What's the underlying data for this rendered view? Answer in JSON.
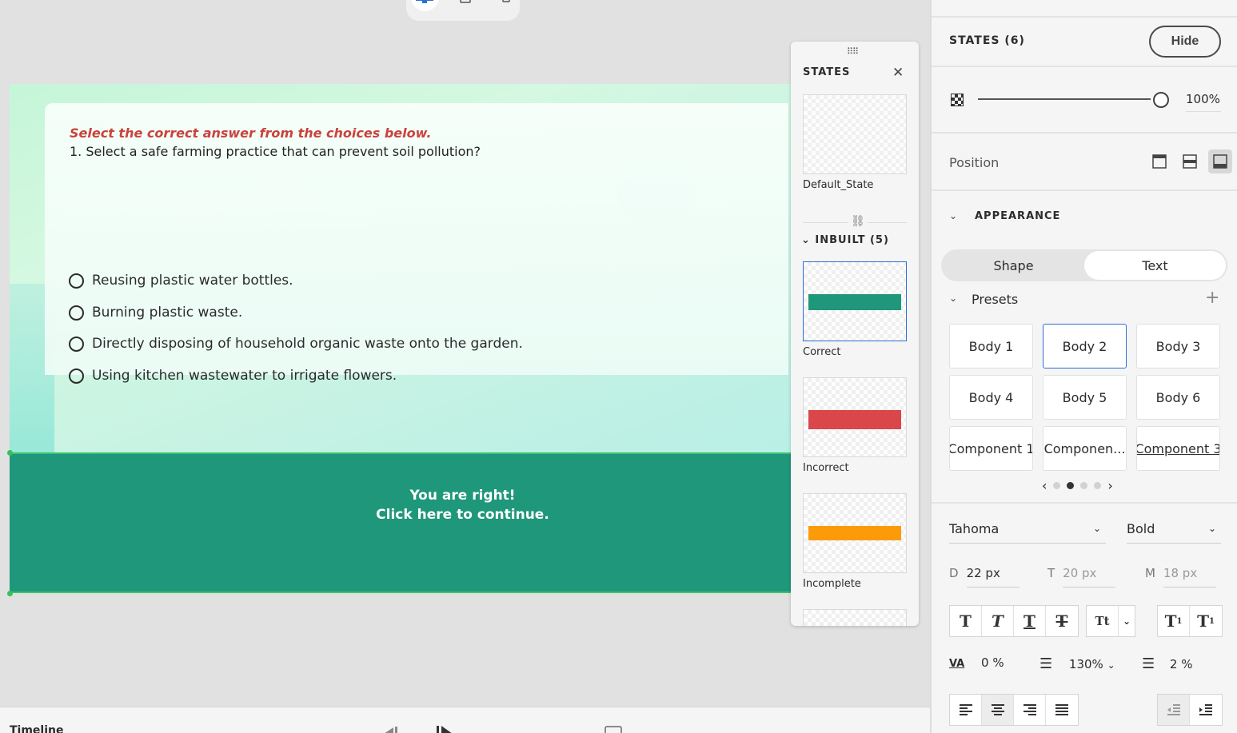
{
  "toolbar": {
    "devices": [
      "desktop-icon",
      "tablet-icon",
      "mobile-icon"
    ],
    "active_device": "desktop"
  },
  "slide": {
    "instruction": "Select the correct answer from the choices below.",
    "question": "1. Select a safe farming practice that can prevent soil pollution?",
    "choices": [
      "Reusing plastic water bottles.",
      "Burning plastic waste.",
      "Directly disposing of household organic waste onto the garden.",
      "Using kitchen wastewater to irrigate flowers."
    ],
    "feedback_line1": "You are right!",
    "feedback_line2": "Click here to continue.",
    "colors": {
      "feedback_bg": "#1f977a",
      "instruction": "#c9433b"
    }
  },
  "states_popover": {
    "title": "STATES",
    "default_state": "Default_State",
    "inbuilt_header": "INBUILT (5)",
    "inbuilt": [
      {
        "label": "Correct",
        "color": "#1f977a"
      },
      {
        "label": "Incorrect",
        "color": "#d9474a"
      },
      {
        "label": "Incomplete",
        "color": "#fb9b0a"
      }
    ]
  },
  "panel": {
    "states_title": "STATES (6)",
    "hide_label": "Hide",
    "opacity": "100%",
    "opacity_value": 1.0,
    "position_label": "Position",
    "appearance_label": "APPEARANCE",
    "tabs": [
      "Shape",
      "Text"
    ],
    "active_tab": "Text",
    "presets_label": "Presets",
    "presets": [
      "Body 1",
      "Body 2",
      "Body 3",
      "Body 4",
      "Body 5",
      "Body 6",
      "Component 1",
      "Componen...",
      "Component 3"
    ],
    "selected_preset": "Body 2",
    "pager_active": 2,
    "font_family": "Tahoma",
    "font_weight": "Bold",
    "size_desktop_label": "D",
    "size_desktop": "22 px",
    "size_tablet_label": "T",
    "size_tablet": "20 px",
    "size_mobile_label": "M",
    "size_mobile": "18 px",
    "letter_spacing": "0 %",
    "line_height": "130%",
    "para_spacing": "2 %"
  },
  "timeline": {
    "label": "Timeline"
  }
}
